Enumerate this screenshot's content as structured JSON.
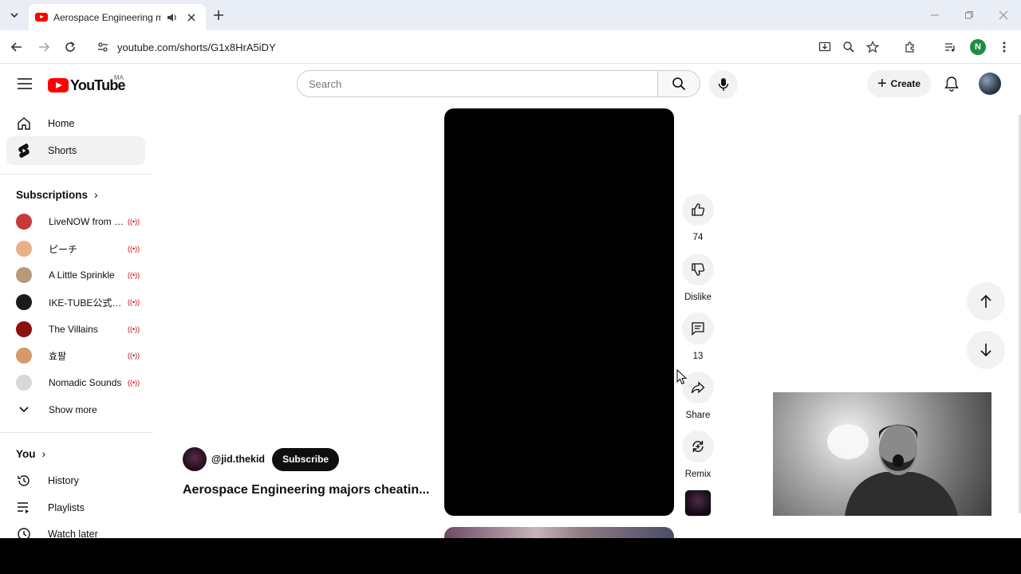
{
  "browser": {
    "tab_title": "Aerospace Engineering majors cheating",
    "url": "youtube.com/shorts/G1x8HrA5iDY",
    "profile_initial": "N"
  },
  "header": {
    "logo_text": "YouTube",
    "country_code": "MA",
    "search_placeholder": "Search",
    "create_label": "Create"
  },
  "sidebar": {
    "primary": [
      {
        "label": "Home",
        "icon": "home-icon"
      },
      {
        "label": "Shorts",
        "icon": "shorts-icon"
      }
    ],
    "subscriptions_heading": "Subscriptions",
    "subscriptions": [
      {
        "name": "LiveNOW from FOX",
        "color": "#c83a3a"
      },
      {
        "name": "ピーチ",
        "color": "#e8b089"
      },
      {
        "name": "A Little Sprinkle",
        "color": "#b89a7a"
      },
      {
        "name": "IKE-TUBE公式CH",
        "color": "#1a1a1a"
      },
      {
        "name": "The Villains",
        "color": "#8b1010"
      },
      {
        "name": "효팔",
        "color": "#d49a6a"
      },
      {
        "name": "Nomadic Sounds",
        "color": "#d8d8d8"
      }
    ],
    "show_more": "Show more",
    "you_heading": "You",
    "you_items": [
      {
        "label": "History",
        "icon": "history-icon"
      },
      {
        "label": "Playlists",
        "icon": "playlists-icon"
      },
      {
        "label": "Watch later",
        "icon": "watch-later-icon"
      }
    ]
  },
  "short": {
    "channel_handle": "@jid.thekid",
    "subscribe_label": "Subscribe",
    "title": "Aerospace Engineering majors cheatin...",
    "like_count": "74",
    "dislike_label": "Dislike",
    "comment_count": "13",
    "share_label": "Share",
    "remix_label": "Remix"
  },
  "colors": {
    "brand_red": "#ff0000",
    "live_red": "#cc0000",
    "chip_bg": "#f2f2f2"
  }
}
